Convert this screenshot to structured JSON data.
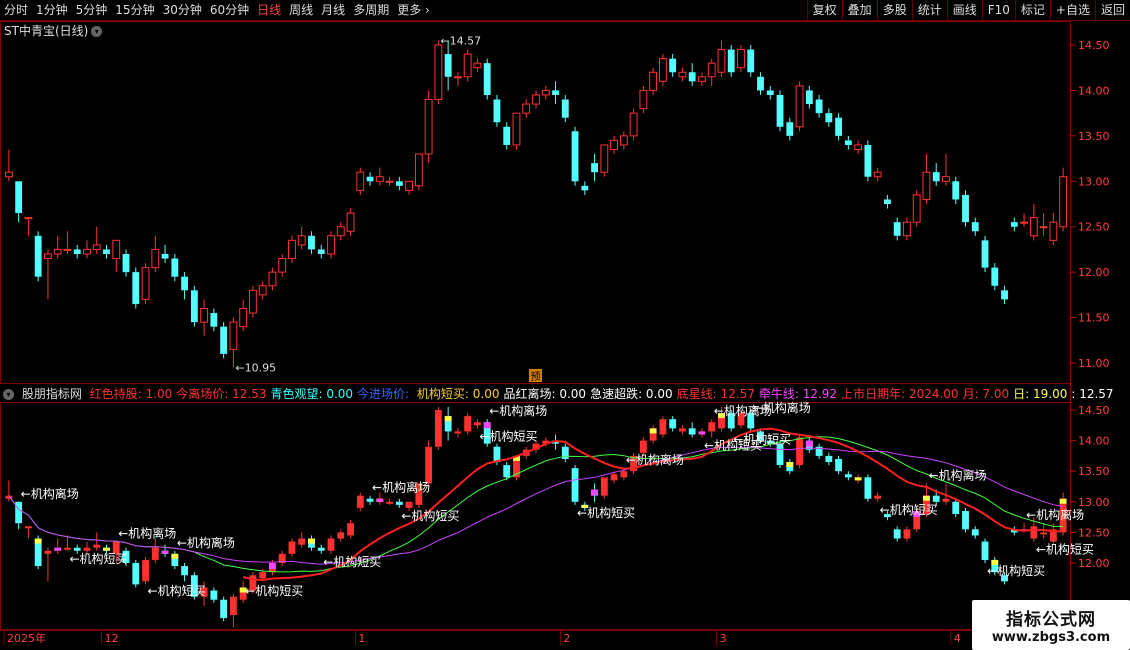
{
  "toolbar": {
    "periods": [
      "分时",
      "1分钟",
      "5分钟",
      "15分钟",
      "30分钟",
      "60分钟",
      "日线",
      "周线",
      "月线",
      "多周期",
      "更多"
    ],
    "active": "日线",
    "buttons": [
      "复权",
      "叠加",
      "多股",
      "统计",
      "画线",
      "F10",
      "标记",
      "+自选",
      "返回"
    ]
  },
  "title": "ST中青宝(日线)",
  "indicator": {
    "name": "股朋指标网",
    "items": [
      {
        "label": "红色持股:",
        "value": "1.00",
        "color": "#ff3333"
      },
      {
        "label": "今离场价:",
        "value": "12.53",
        "color": "#ff3333"
      },
      {
        "label": "青色观望:",
        "value": "0.00",
        "color": "#33ffff"
      },
      {
        "label": "今进场价:",
        "value": "",
        "color": "#3366ff"
      },
      {
        "label": "机构短买:",
        "value": "0.00",
        "color": "#ffcc33"
      },
      {
        "label": "品红离场:",
        "value": "0.00",
        "color": "#ffffff"
      },
      {
        "label": "急速超跌:",
        "value": "0.00",
        "color": "#ffffff"
      },
      {
        "label": "底星线:",
        "value": "12.57",
        "color": "#ff3333"
      },
      {
        "label": "牵牛线:",
        "value": "12.92",
        "color": "#ff44ff"
      },
      {
        "label": "上市日期年:",
        "value": "2024.00",
        "color": "#ff3333"
      },
      {
        "label": "月:",
        "value": "7.00",
        "color": "#ff3333"
      },
      {
        "label": "日:",
        "value": "19.00",
        "color": "#ffff55"
      },
      {
        "label": ":",
        "value": "12.57",
        "color": "#ffffff"
      }
    ]
  },
  "labels": {
    "high_mark": "14.57",
    "low_mark": "10.95",
    "pre_badge": "预",
    "exit_text": "←机构离场",
    "buy_text": "←机构短买"
  },
  "watermark": {
    "title": "指标公式网",
    "url": "www.zbgs3.com"
  },
  "chart_data": {
    "type": "candlestick",
    "y_ticks_main": [
      "14.50",
      "14.00",
      "13.50",
      "13.00",
      "12.50",
      "12.00",
      "11.50",
      "11.00"
    ],
    "y_ticks_ind": [
      "14.50",
      "14.00",
      "13.50",
      "13.00",
      "12.50",
      "12.00"
    ],
    "x_labels": [
      {
        "text": "2025年",
        "index": 0
      },
      {
        "text": "12",
        "index": 10
      },
      {
        "text": "1",
        "index": 36
      },
      {
        "text": "2",
        "index": 57
      },
      {
        "text": "3",
        "index": 73
      },
      {
        "text": "4",
        "index": 97
      }
    ],
    "ylim": [
      10.8,
      14.8
    ],
    "candles": [
      [
        13.05,
        13.1,
        13.0,
        13.35
      ],
      [
        13.0,
        12.65,
        12.55,
        13.0
      ],
      [
        12.6,
        12.6,
        12.4,
        12.6
      ],
      [
        12.4,
        11.95,
        11.9,
        12.45
      ],
      [
        12.15,
        12.2,
        11.7,
        12.25
      ],
      [
        12.2,
        12.25,
        12.15,
        12.4
      ],
      [
        12.25,
        12.25,
        12.2,
        12.45
      ],
      [
        12.25,
        12.2,
        12.15,
        12.3
      ],
      [
        12.2,
        12.25,
        12.15,
        12.35
      ],
      [
        12.25,
        12.3,
        12.2,
        12.5
      ],
      [
        12.25,
        12.2,
        12.15,
        12.3
      ],
      [
        12.15,
        12.35,
        12.0,
        12.35
      ],
      [
        12.2,
        12.0,
        11.95,
        12.25
      ],
      [
        12.0,
        11.65,
        11.6,
        12.05
      ],
      [
        11.7,
        12.05,
        11.65,
        12.1
      ],
      [
        12.05,
        12.25,
        12.0,
        12.4
      ],
      [
        12.2,
        12.15,
        12.1,
        12.3
      ],
      [
        12.15,
        11.95,
        11.9,
        12.2
      ],
      [
        11.95,
        11.8,
        11.7,
        12.0
      ],
      [
        11.8,
        11.45,
        11.4,
        11.85
      ],
      [
        11.45,
        11.6,
        11.3,
        11.7
      ],
      [
        11.55,
        11.4,
        11.35,
        11.6
      ],
      [
        11.4,
        11.1,
        11.05,
        11.45
      ],
      [
        11.15,
        11.45,
        10.95,
        11.5
      ],
      [
        11.4,
        11.6,
        11.35,
        11.7
      ],
      [
        11.55,
        11.8,
        11.5,
        11.85
      ],
      [
        11.75,
        11.85,
        11.7,
        11.9
      ],
      [
        11.85,
        12.0,
        11.8,
        12.05
      ],
      [
        12.0,
        12.15,
        11.95,
        12.2
      ],
      [
        12.15,
        12.35,
        12.1,
        12.4
      ],
      [
        12.3,
        12.4,
        12.25,
        12.5
      ],
      [
        12.4,
        12.25,
        12.2,
        12.45
      ],
      [
        12.25,
        12.2,
        12.15,
        12.3
      ],
      [
        12.2,
        12.4,
        12.15,
        12.45
      ],
      [
        12.4,
        12.5,
        12.35,
        12.55
      ],
      [
        12.45,
        12.65,
        12.4,
        12.7
      ],
      [
        12.9,
        13.1,
        12.85,
        13.15
      ],
      [
        13.05,
        13.0,
        12.95,
        13.1
      ],
      [
        13.0,
        13.05,
        12.95,
        13.15
      ],
      [
        13.0,
        13.0,
        12.95,
        13.05
      ],
      [
        13.0,
        12.95,
        12.9,
        13.05
      ],
      [
        12.9,
        13.0,
        12.85,
        13.0
      ],
      [
        12.95,
        13.3,
        12.9,
        13.3
      ],
      [
        13.3,
        13.9,
        13.2,
        14.0
      ],
      [
        13.9,
        14.5,
        13.85,
        14.55
      ],
      [
        14.4,
        14.15,
        14.0,
        14.55
      ],
      [
        14.15,
        14.15,
        14.05,
        14.2
      ],
      [
        14.15,
        14.4,
        14.1,
        14.45
      ],
      [
        14.25,
        14.3,
        14.2,
        14.35
      ],
      [
        14.3,
        13.95,
        13.9,
        14.35
      ],
      [
        13.9,
        13.65,
        13.6,
        13.95
      ],
      [
        13.6,
        13.4,
        13.35,
        13.65
      ],
      [
        13.4,
        13.75,
        13.35,
        13.75
      ],
      [
        13.75,
        13.85,
        13.7,
        13.9
      ],
      [
        13.85,
        13.95,
        13.8,
        14.0
      ],
      [
        13.95,
        14.0,
        13.9,
        14.05
      ],
      [
        14.0,
        13.95,
        13.85,
        14.1
      ],
      [
        13.9,
        13.7,
        13.65,
        13.95
      ],
      [
        13.55,
        13.0,
        12.95,
        13.6
      ],
      [
        12.95,
        12.9,
        12.85,
        13.0
      ],
      [
        13.2,
        13.1,
        13.0,
        13.3
      ],
      [
        13.1,
        13.4,
        13.05,
        13.4
      ],
      [
        13.35,
        13.45,
        13.3,
        13.5
      ],
      [
        13.4,
        13.5,
        13.35,
        13.55
      ],
      [
        13.5,
        13.75,
        13.45,
        13.8
      ],
      [
        13.8,
        14.0,
        13.75,
        14.05
      ],
      [
        14.0,
        14.2,
        13.95,
        14.25
      ],
      [
        14.1,
        14.35,
        14.05,
        14.4
      ],
      [
        14.35,
        14.2,
        14.15,
        14.4
      ],
      [
        14.15,
        14.2,
        14.1,
        14.25
      ],
      [
        14.2,
        14.1,
        14.05,
        14.3
      ],
      [
        14.1,
        14.15,
        14.05,
        14.2
      ],
      [
        14.15,
        14.3,
        14.05,
        14.35
      ],
      [
        14.2,
        14.45,
        14.15,
        14.55
      ],
      [
        14.45,
        14.2,
        14.15,
        14.5
      ],
      [
        14.25,
        14.45,
        14.2,
        14.5
      ],
      [
        14.45,
        14.2,
        14.15,
        14.5
      ],
      [
        14.15,
        14.0,
        13.95,
        14.2
      ],
      [
        14.0,
        13.95,
        13.9,
        14.05
      ],
      [
        13.95,
        13.6,
        13.55,
        14.0
      ],
      [
        13.65,
        13.5,
        13.45,
        13.7
      ],
      [
        13.6,
        14.05,
        13.55,
        14.1
      ],
      [
        14.0,
        13.85,
        13.8,
        14.05
      ],
      [
        13.9,
        13.75,
        13.7,
        13.95
      ],
      [
        13.75,
        13.65,
        13.6,
        13.8
      ],
      [
        13.7,
        13.5,
        13.45,
        13.75
      ],
      [
        13.45,
        13.4,
        13.35,
        13.5
      ],
      [
        13.35,
        13.4,
        13.3,
        13.45
      ],
      [
        13.4,
        13.05,
        13.0,
        13.45
      ],
      [
        13.05,
        13.1,
        13.0,
        13.15
      ],
      [
        12.8,
        12.75,
        12.7,
        12.85
      ],
      [
        12.55,
        12.4,
        12.35,
        12.6
      ],
      [
        12.4,
        12.55,
        12.35,
        12.6
      ],
      [
        12.55,
        12.85,
        12.5,
        12.9
      ],
      [
        12.8,
        13.1,
        12.75,
        13.3
      ],
      [
        13.1,
        13.0,
        12.95,
        13.2
      ],
      [
        13.0,
        13.05,
        12.95,
        13.3
      ],
      [
        13.0,
        12.8,
        12.75,
        13.05
      ],
      [
        12.85,
        12.55,
        12.5,
        12.9
      ],
      [
        12.55,
        12.45,
        12.4,
        12.6
      ],
      [
        12.35,
        12.05,
        12.0,
        12.4
      ],
      [
        12.05,
        11.85,
        11.8,
        12.1
      ],
      [
        11.8,
        11.7,
        11.65,
        11.85
      ],
      [
        12.55,
        12.5,
        12.45,
        12.6
      ],
      [
        12.55,
        12.55,
        12.5,
        12.65
      ],
      [
        12.4,
        12.6,
        12.35,
        12.75
      ],
      [
        12.5,
        12.5,
        12.4,
        12.65
      ],
      [
        12.35,
        12.55,
        12.3,
        12.65
      ],
      [
        12.5,
        13.05,
        12.45,
        13.15
      ]
    ]
  }
}
